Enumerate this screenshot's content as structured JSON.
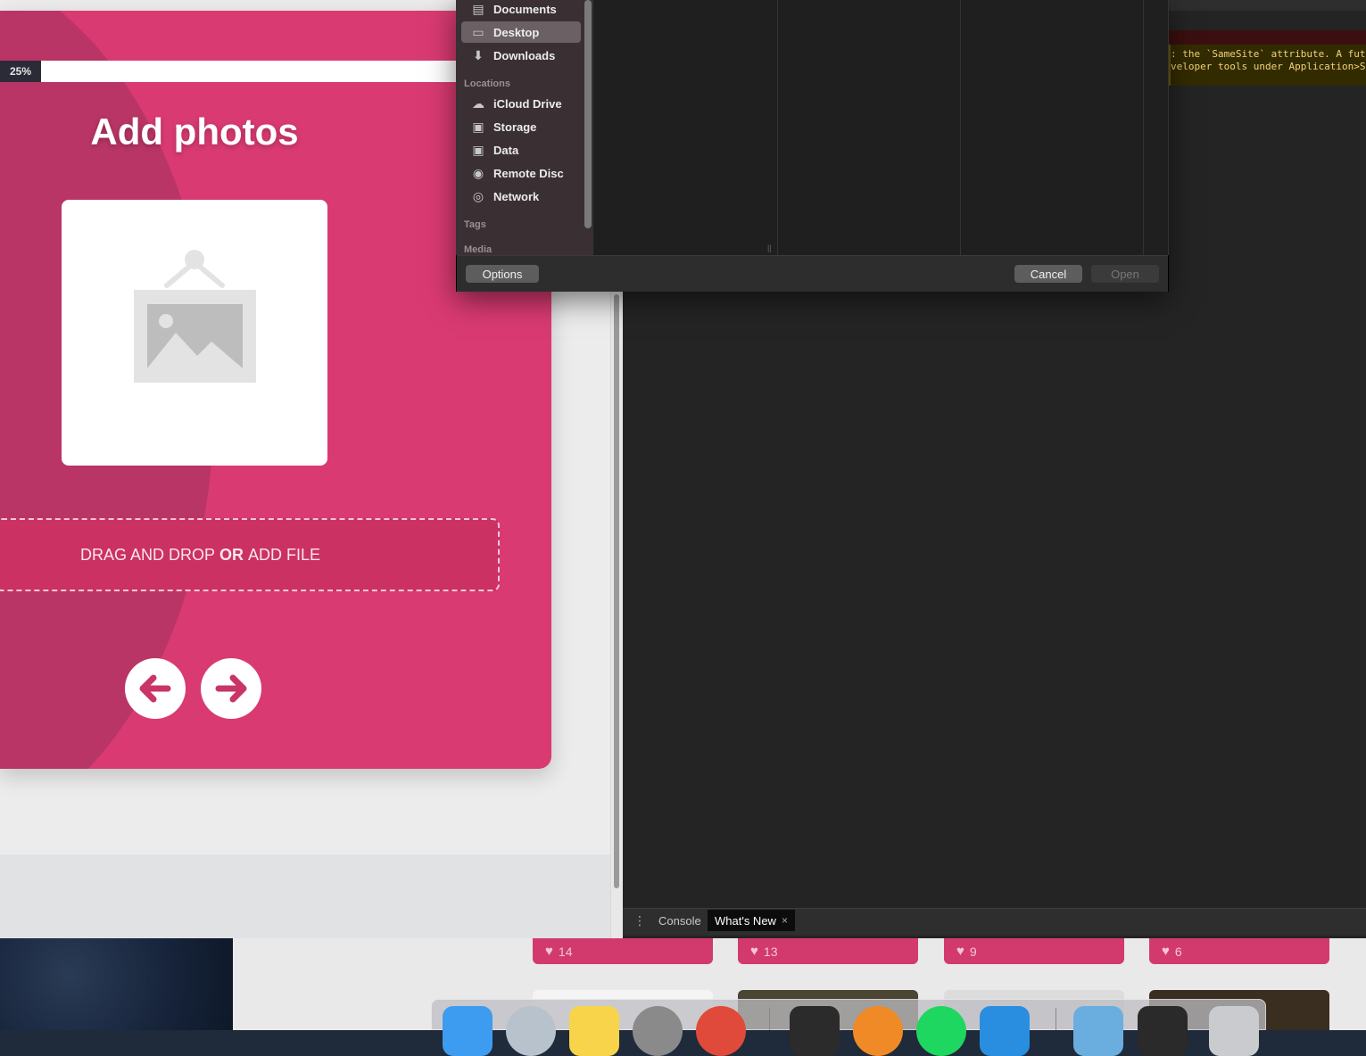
{
  "upload_card": {
    "progress_label": "25%",
    "progress_value": 0.25,
    "title": "Add photos",
    "drop_text_before": "DRAG AND DROP",
    "drop_text_or": "OR",
    "drop_text_after": "ADD FILE"
  },
  "file_dialog": {
    "sidebar": {
      "favorites": [
        {
          "label": "Documents",
          "icon": "documents-icon"
        },
        {
          "label": "Desktop",
          "icon": "desktop-icon",
          "selected": true
        },
        {
          "label": "Downloads",
          "icon": "downloads-icon"
        }
      ],
      "locations_header": "Locations",
      "locations": [
        {
          "label": "iCloud Drive",
          "icon": "cloud-icon"
        },
        {
          "label": "Storage",
          "icon": "disk-icon"
        },
        {
          "label": "Data",
          "icon": "disk-icon"
        },
        {
          "label": "Remote Disc",
          "icon": "disc-icon"
        },
        {
          "label": "Network",
          "icon": "network-icon"
        }
      ],
      "tags_header": "Tags",
      "media_header": "Media"
    },
    "buttons": {
      "options": "Options",
      "cancel": "Cancel",
      "open": "Open"
    }
  },
  "devtools": {
    "warning_line1": ": the `SameSite` attribute. A futu",
    "warning_line2": "veloper tools under Application>St",
    "drawer_tabs": {
      "console": "Console",
      "whats_new": "What's New",
      "close": "×"
    }
  },
  "background_feed": {
    "likes": [
      "14",
      "13",
      "9",
      "6"
    ]
  },
  "colors": {
    "card_pink": "#d93a72",
    "card_shade": "#b93565",
    "devtools_bg": "#242424",
    "dialog_bg": "#2a2a2a"
  }
}
